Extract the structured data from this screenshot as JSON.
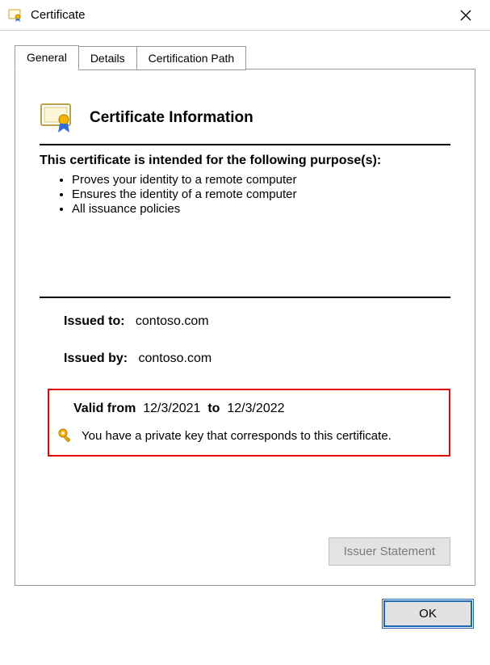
{
  "window": {
    "title": "Certificate"
  },
  "tabs": [
    {
      "label": "General",
      "active": true
    },
    {
      "label": "Details",
      "active": false
    },
    {
      "label": "Certification Path",
      "active": false
    }
  ],
  "content": {
    "heading": "Certificate Information",
    "purpose_heading": "This certificate is intended for the following purpose(s):",
    "purposes": [
      "Proves your identity to a remote computer",
      "Ensures the identity of a remote computer",
      "All issuance policies"
    ],
    "issued_to_label": "Issued to:",
    "issued_to_value": "contoso.com",
    "issued_by_label": "Issued by:",
    "issued_by_value": "contoso.com",
    "valid_from_label": "Valid from",
    "valid_from_value": "12/3/2021",
    "valid_to_label": "to",
    "valid_to_value": "12/3/2022",
    "private_key_msg": "You have a private key that corresponds to this certificate.",
    "issuer_statement_btn": "Issuer Statement"
  },
  "buttons": {
    "ok": "OK"
  }
}
